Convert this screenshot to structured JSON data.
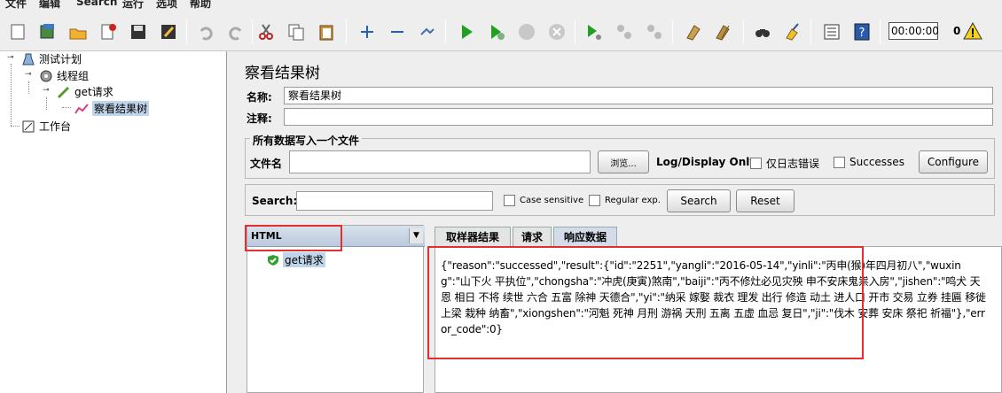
{
  "menu": [
    "文件",
    "编辑",
    "Search",
    "运行",
    "选项",
    "帮助"
  ],
  "toolbar": {
    "icons": [
      "new-icon",
      "templates-icon",
      "open-icon",
      "close-icon",
      "save-icon",
      "save-as-icon",
      "undo-icon",
      "redo-icon",
      "cut-icon",
      "copy-icon",
      "paste-icon",
      "expand-icon",
      "collapse-icon",
      "toggle-icon",
      "start-icon",
      "start-no-pause-icon",
      "stop-icon",
      "shutdown-icon",
      "remote-start-icon",
      "remote-stop-icon",
      "remote-shutdown-icon",
      "clear-icon",
      "clear-all-icon",
      "search-icon",
      "reset-search-icon",
      "function-helper-icon",
      "help-icon"
    ],
    "timer": "00:00:00",
    "error_count": "0"
  },
  "tree": {
    "test_plan": "测试计划",
    "thread_group": "线程组",
    "sampler": "get请求",
    "listener": "察看结果树",
    "workbench": "工作台"
  },
  "panel": {
    "title": "察看结果树",
    "name_label": "名称:",
    "name_value": "察看结果树",
    "comment_label": "注释:",
    "comment_value": "",
    "file_group_title": "所有数据写入一个文件",
    "filename_label": "文件名",
    "filename_value": "",
    "browse_button": "浏览...",
    "log_display_label": "Log/Display Only:",
    "errors_only_label": "仅日志错误",
    "successes_label": "Successes",
    "configure_button": "Configure",
    "search_label": "Search:",
    "search_value": "",
    "case_sensitive_label": "Case sensitive",
    "regular_exp_label": "Regular exp.",
    "search_button": "Search",
    "reset_button": "Reset"
  },
  "results": {
    "renderer": "HTML",
    "item": "get请求",
    "tabs": [
      "取样器结果",
      "请求",
      "响应数据"
    ],
    "active_tab": "响应数据",
    "response": "{\"reason\":\"successed\",\"result\":{\"id\":\"2251\",\"yangli\":\"2016-05-14\",\"yinli\":\"丙申(猴)年四月初八\",\"wuxing\":\"山下火 平执位\",\"chongsha\":\"冲虎(庚寅)煞南\",\"baiji\":\"丙不修灶必见灾殃 申不安床鬼祟入房\",\"jishen\":\"鸣犬 天恩 相日 不将 续世 六合 五富 除神 天德合\",\"yi\":\"纳采 嫁娶 裁衣 理发 出行 修造 动土 进人口 开市 交易 立券 挂匾 移徙 上梁 栽种 纳畜\",\"xiongshen\":\"河魁 死神 月刑 游祸 天刑 五离 五虚 血忌 复日\",\"ji\":\"伐木 安葬 安床 祭祀 祈福\"},\"error_code\":0}"
  },
  "colors": {
    "highlight": "#e03030",
    "selection": "#c0d4ea"
  }
}
